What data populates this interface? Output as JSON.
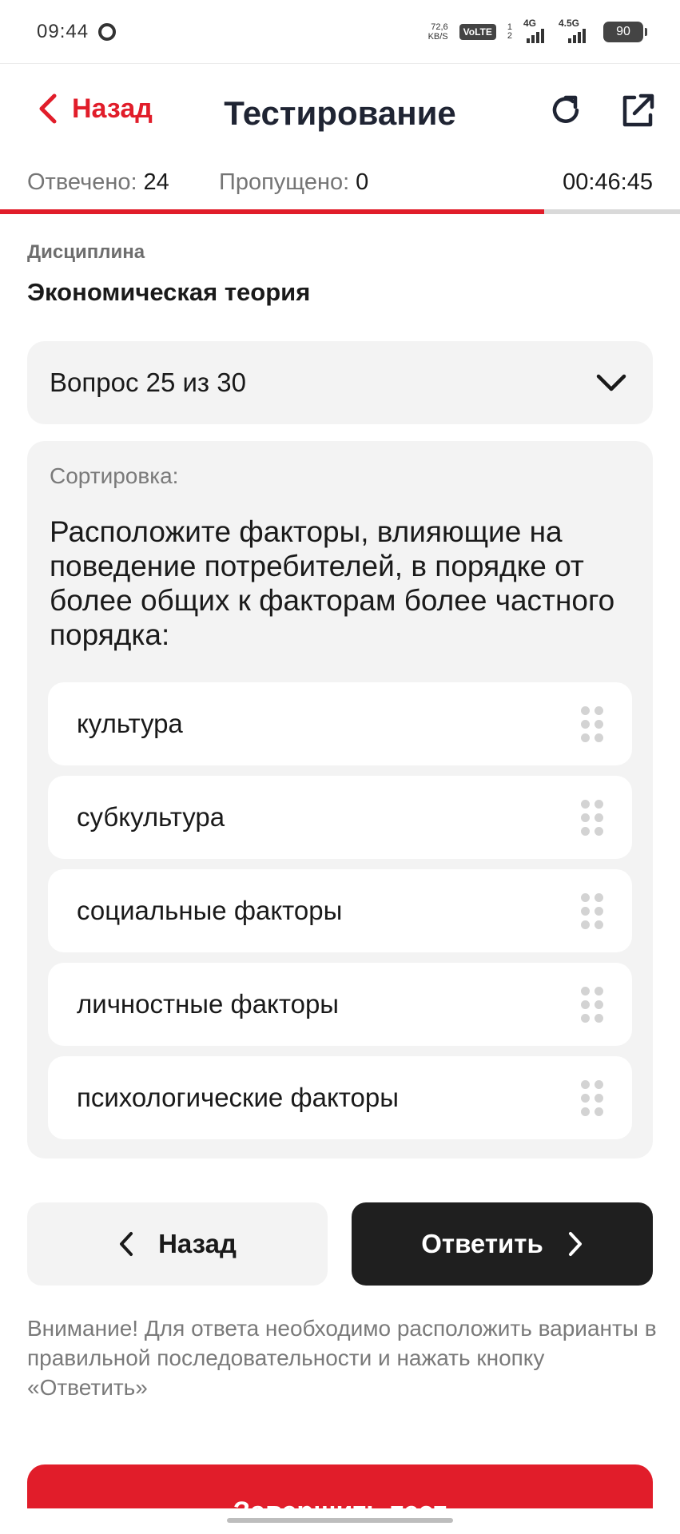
{
  "status_bar": {
    "time": "09:44",
    "net_speed_value": "72,6",
    "net_speed_unit": "KB/S",
    "volte": "VoLTE",
    "sim1": "1",
    "sim2": "2",
    "net1": "4G",
    "net2": "4.5G",
    "battery": "90"
  },
  "header": {
    "back_label": "Назад",
    "title": "Тестирование"
  },
  "counters": {
    "answered_label": "Отвечено:",
    "answered_value": "24",
    "skipped_label": "Пропущено:",
    "skipped_value": "0",
    "timer": "00:46:45",
    "progress": 0.8
  },
  "discipline": {
    "label": "Дисциплина",
    "name": "Экономическая теория"
  },
  "question_selector": {
    "label": "Вопрос 25 из 30"
  },
  "question": {
    "type": "Сортировка:",
    "text": "Расположите факторы, влияющие на поведение потребителей, в порядке от более общих к факторам более частного порядка:",
    "options": [
      "культура",
      "субкультура",
      "социальные факторы",
      "личностные факторы",
      "психологические факторы"
    ]
  },
  "actions": {
    "back_label": "Назад",
    "answer_label": "Ответить",
    "notice": "Внимание! Для ответа необходимо расположить варианты в правильной последовательности и нажать кнопку «Ответить»",
    "finish_label": "Завершить тест"
  },
  "colors": {
    "accent": "#e11d2a",
    "dark_button": "#1f1f1f",
    "card_bg": "#f3f3f3"
  }
}
